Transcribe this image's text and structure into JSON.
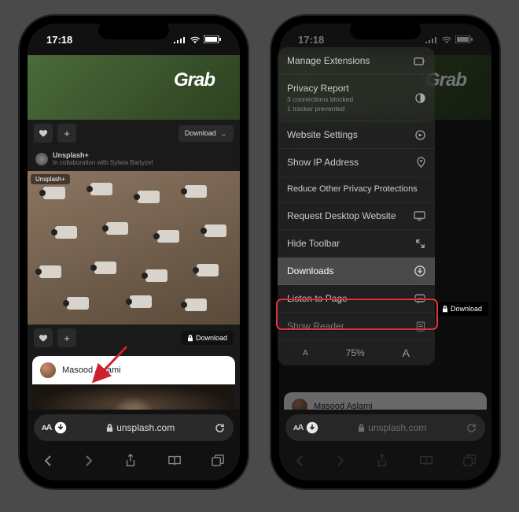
{
  "status": {
    "time": "17:18"
  },
  "hero": {
    "brand": "Grab"
  },
  "actions": {
    "download": "Download",
    "download_locked": "Download"
  },
  "author": {
    "name": "Unsplash+",
    "collab": "In collaboration with Sylwia Bartyzel"
  },
  "badge_unsplash": "Unsplash+",
  "user_card": {
    "name": "Masood Aslami"
  },
  "address": {
    "domain": "unsplash.com"
  },
  "menu": {
    "items": [
      {
        "label": "Manage Extensions",
        "icon": "extensions"
      },
      {
        "label": "Privacy Report",
        "sub1": "3 connections blocked",
        "sub2": "1 tracker prevented",
        "icon": "privacy"
      },
      {
        "label": "Website Settings",
        "icon": "settings"
      },
      {
        "label": "Show IP Address",
        "icon": "location"
      },
      {
        "label": "Reduce Other Privacy Protections",
        "icon": ""
      },
      {
        "label": "Request Desktop Website",
        "icon": "desktop"
      },
      {
        "label": "Hide Toolbar",
        "icon": "expand"
      },
      {
        "label": "Downloads",
        "icon": "download"
      },
      {
        "label": "Listen to Page",
        "icon": "listen"
      },
      {
        "label": "Show Reader",
        "icon": "reader"
      }
    ],
    "zoom": {
      "value": "75%"
    }
  },
  "colors": {
    "highlight": "#e53040"
  }
}
